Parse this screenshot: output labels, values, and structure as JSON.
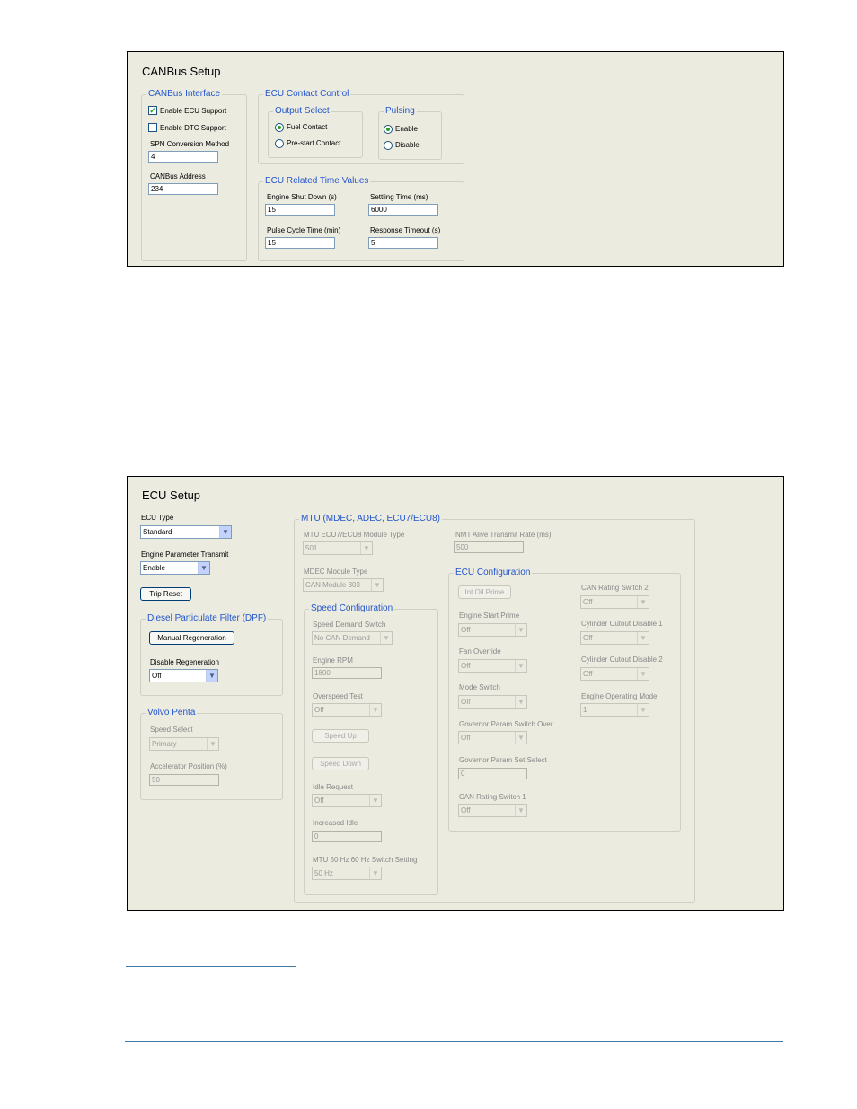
{
  "canbus": {
    "title": "CANBus Setup",
    "interface": {
      "title": "CANBus Interface",
      "enable_ecu": "Enable ECU Support",
      "enable_dtc": "Enable DTC Support",
      "spn_label": "SPN Conversion Method",
      "spn_value": "4",
      "address_label": "CANBus Address",
      "address_value": "234"
    },
    "contact": {
      "title": "ECU Contact Control",
      "output_title": "Output Select",
      "fuel": "Fuel Contact",
      "prestart": "Pre-start Contact",
      "pulsing_title": "Pulsing",
      "enable": "Enable",
      "disable": "Disable"
    },
    "time": {
      "title": "ECU Related Time Values",
      "shutdown_label": "Engine Shut Down (s)",
      "shutdown_value": "15",
      "settling_label": "Settling Time (ms)",
      "settling_value": "6000",
      "pulse_label": "Pulse Cycle Time (min)",
      "pulse_value": "15",
      "response_label": "Response Timeout (s)",
      "response_value": "5"
    }
  },
  "ecu": {
    "title": "ECU Setup",
    "type_label": "ECU Type",
    "type_value": "Standard",
    "transmit_label": "Engine Parameter Transmit",
    "transmit_value": "Enable",
    "trip_reset": "Trip Reset",
    "dpf": {
      "title": "Diesel Particulate Filter (DPF)",
      "manual_regen": "Manual Regeneration",
      "disable_label": "Disable Regeneration",
      "disable_value": "Off"
    },
    "volvo": {
      "title": "Volvo Penta",
      "speed_label": "Speed Select",
      "speed_value": "Primary",
      "accel_label": "Accelerator Position (%)",
      "accel_value": "50"
    },
    "mtu": {
      "title": "MTU (MDEC, ADEC, ECU7/ECU8)",
      "module_type_label": "MTU ECU7/ECU8 Module Type",
      "module_type_value": "501",
      "nmt_label": "NMT Alive Transmit Rate (ms)",
      "nmt_value": "500",
      "mdec_label": "MDEC Module Type",
      "mdec_value": "CAN Module 303",
      "speed": {
        "title": "Speed Configuration",
        "demand_label": "Speed Demand Switch",
        "demand_value": "No CAN Demand",
        "rpm_label": "Engine RPM",
        "rpm_value": "1800",
        "overspeed_label": "Overspeed Test",
        "overspeed_value": "Off",
        "speed_up": "Speed Up",
        "speed_down": "Speed Down",
        "idle_label": "Idle Request",
        "idle_value": "Off",
        "increased_label": "Increased Idle",
        "increased_value": "0",
        "hz_label": "MTU 50 Hz 60 Hz Switch Setting",
        "hz_value": "50 Hz"
      },
      "config": {
        "title": "ECU Configuration",
        "int_oil": "Int Oil Prime",
        "start_prime_label": "Engine Start Prime",
        "start_prime_value": "Off",
        "fan_label": "Fan Override",
        "fan_value": "Off",
        "mode_label": "Mode Switch",
        "mode_value": "Off",
        "gov_over_label": "Governor Param Switch Over",
        "gov_over_value": "Off",
        "gov_set_label": "Governor Param Set Select",
        "gov_set_value": "0",
        "can1_label": "CAN Rating Switch 1",
        "can1_value": "Off",
        "can2_label": "CAN Rating Switch 2",
        "can2_value": "Off",
        "cyl1_label": "Cylinder Cutout Disable 1",
        "cyl1_value": "Off",
        "cyl2_label": "Cylinder Cutout Disable 2",
        "cyl2_value": "Off",
        "opmode_label": "Engine Operating Mode",
        "opmode_value": "1"
      }
    }
  }
}
